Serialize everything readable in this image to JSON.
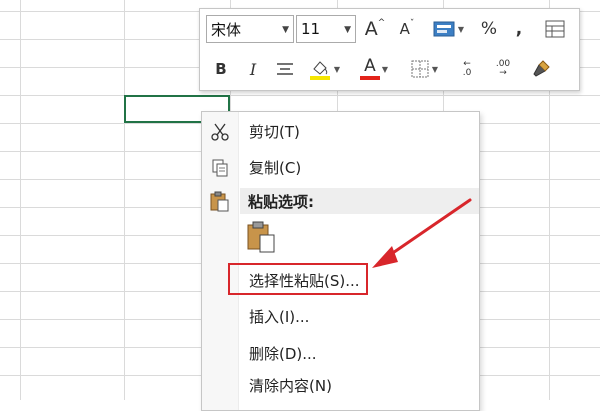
{
  "mini_toolbar": {
    "font_name": "宋体",
    "font_size": "11",
    "grow_font_label": "A",
    "shrink_font_label": "A",
    "percent_label": "%",
    "comma_label": ",",
    "bold_label": "B",
    "italic_label": "I",
    "font_color_label": "A",
    "increase_decimal_label": ".00",
    "decrease_decimal_label": ".0"
  },
  "context_menu": {
    "cut": "剪切(T)",
    "copy": "复制(C)",
    "paste_options_header": "粘贴选项:",
    "paste_special": "选择性粘贴(S)...",
    "insert": "插入(I)...",
    "delete": "删除(D)...",
    "clear_contents": "清除内容(N)"
  },
  "colors": {
    "accent_green": "#217346",
    "highlight_red": "#d8262b",
    "fill_yellow": "#f5e600",
    "font_red": "#e3231a"
  }
}
